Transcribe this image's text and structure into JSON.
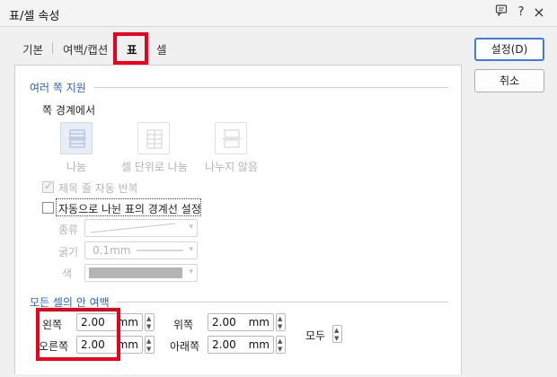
{
  "window": {
    "title": "표/셀 속성",
    "help_icon": "?",
    "close_icon": "×"
  },
  "tabs": [
    "기본",
    "여백/캡션",
    "표",
    "셀"
  ],
  "section_split": {
    "title": "여러 쪽 지원",
    "subtitle": "쪽 경계에서",
    "options": [
      "나눔",
      "셀 단위로 나눔",
      "나누지 않음"
    ],
    "repeat_header": "제목 줄 자동 반복",
    "auto_border": "자동으로 나뉜 표의 경계선 설정",
    "type_label": "종류",
    "thickness_label": "굵기",
    "thickness_value": "0.1mm",
    "color_label": "색"
  },
  "section_margin": {
    "title": "모든 셀의 안 여백",
    "left_label": "왼쪽",
    "left_value": "2.00",
    "right_label": "오른쪽",
    "right_value": "2.00",
    "top_label": "위쪽",
    "top_value": "2.00",
    "bottom_label": "아래쪽",
    "bottom_value": "2.00",
    "unit": "mm",
    "all_label": "모두"
  },
  "buttons": {
    "ok": "설정(D)",
    "cancel": "취소"
  },
  "colors": {
    "accent": "#2b66c3",
    "highlight": "#e8001c"
  }
}
